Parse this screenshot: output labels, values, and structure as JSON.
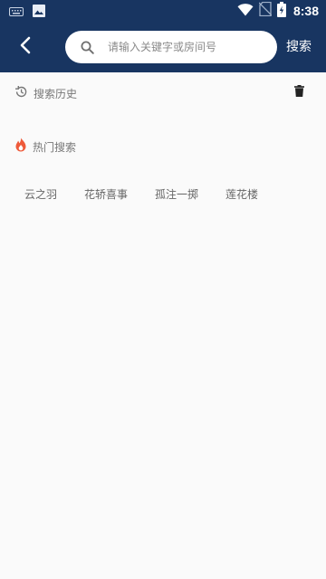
{
  "status_bar": {
    "time": "8:38",
    "left_icons": [
      "keyboard-icon",
      "image-icon"
    ],
    "right_icons": [
      "wifi-icon",
      "no-sim-icon",
      "battery-icon"
    ],
    "background": "#183561"
  },
  "header": {
    "back_icon": "back-arrow-icon",
    "search": {
      "icon": "search-icon",
      "placeholder": "请输入关键字或房间号",
      "value": ""
    },
    "search_button_label": "搜索"
  },
  "history": {
    "icon": "history-icon",
    "label": "搜索历史",
    "delete_icon": "trash-icon"
  },
  "hot": {
    "icon": "fire-icon",
    "label": "热门搜索",
    "accent": "#ee5a3a",
    "tags": [
      "云之羽",
      "花轿喜事",
      "孤注一掷",
      "莲花楼"
    ]
  }
}
